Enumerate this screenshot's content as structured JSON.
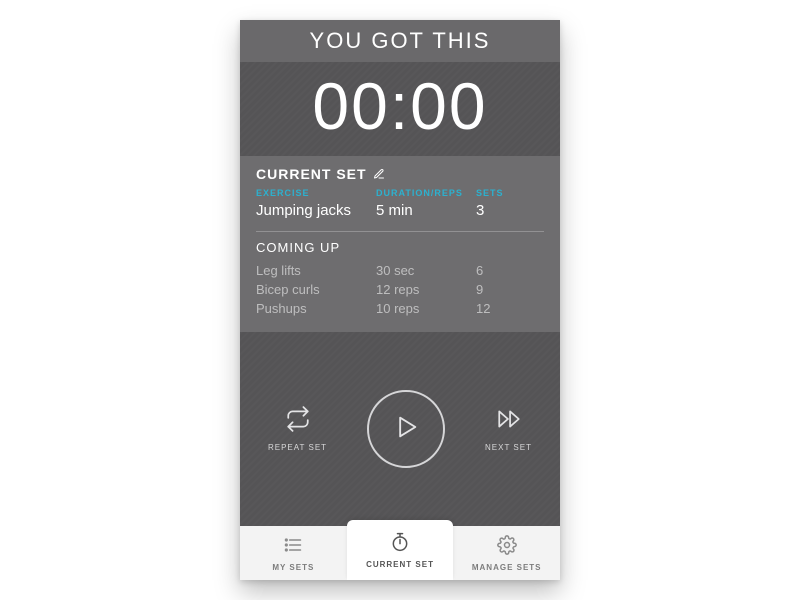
{
  "header": {
    "title": "YOU GOT THIS"
  },
  "timer": {
    "display": "00:00"
  },
  "current_set": {
    "section_label": "CURRENT SET",
    "columns": {
      "exercise": "EXERCISE",
      "duration": "DURATION/REPS",
      "sets": "SETS"
    },
    "row": {
      "exercise": "Jumping jacks",
      "duration": "5 min",
      "sets": "3"
    }
  },
  "coming_up": {
    "section_label": "COMING UP",
    "rows": [
      {
        "exercise": "Leg lifts",
        "duration": "30 sec",
        "sets": "6"
      },
      {
        "exercise": "Bicep curls",
        "duration": "12 reps",
        "sets": "9"
      },
      {
        "exercise": "Pushups",
        "duration": "10 reps",
        "sets": "12"
      }
    ]
  },
  "controls": {
    "repeat_label": "REPEAT SET",
    "next_label": "NEXT SET"
  },
  "tabs": {
    "my_sets": "MY SETS",
    "current_set": "CURRENT SET",
    "manage_sets": "MANAGE SETS"
  },
  "colors": {
    "accent": "#2cb1cf"
  }
}
